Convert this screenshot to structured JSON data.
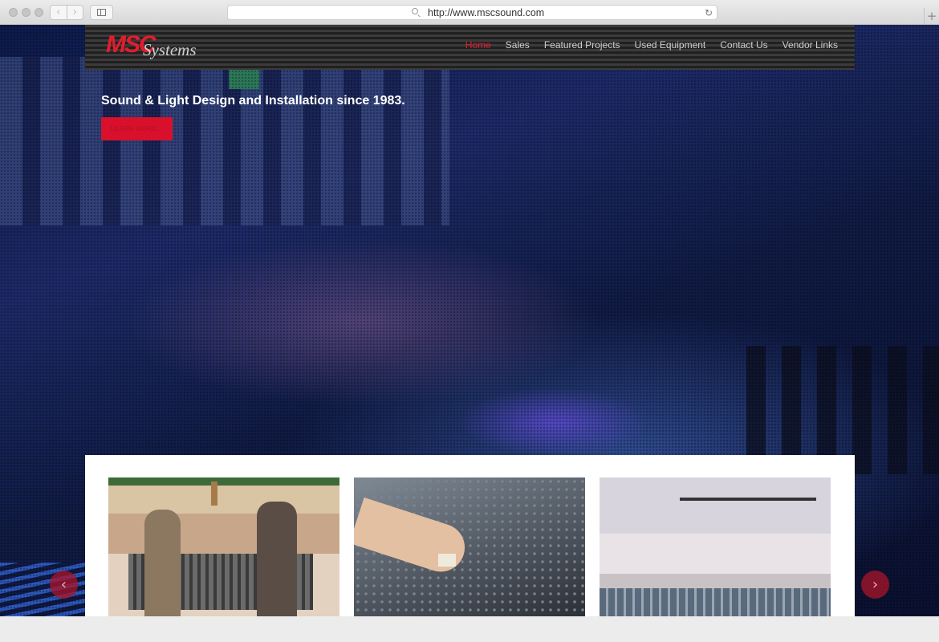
{
  "browser": {
    "url": "http://www.mscsound.com",
    "back_icon": "‹",
    "forward_icon": "›",
    "reload_icon": "↻",
    "new_tab_icon": "+"
  },
  "site": {
    "logo_main": "MSC",
    "logo_script": "Systems",
    "nav": [
      {
        "label": "Home",
        "active": true
      },
      {
        "label": "Sales"
      },
      {
        "label": "Featured Projects"
      },
      {
        "label": "Used Equipment"
      },
      {
        "label": "Contact Us"
      },
      {
        "label": "Vendor Links"
      }
    ],
    "hero": {
      "title": "Sound & Light Design and Installation since 1983.",
      "button": "LEARN MORE..."
    },
    "slider": {
      "prev_icon": "‹",
      "next_icon": "›"
    }
  },
  "colors": {
    "brand_red": "#e51c2c",
    "header_bg": "#2a2a2a",
    "button_red": "#d8102b"
  }
}
